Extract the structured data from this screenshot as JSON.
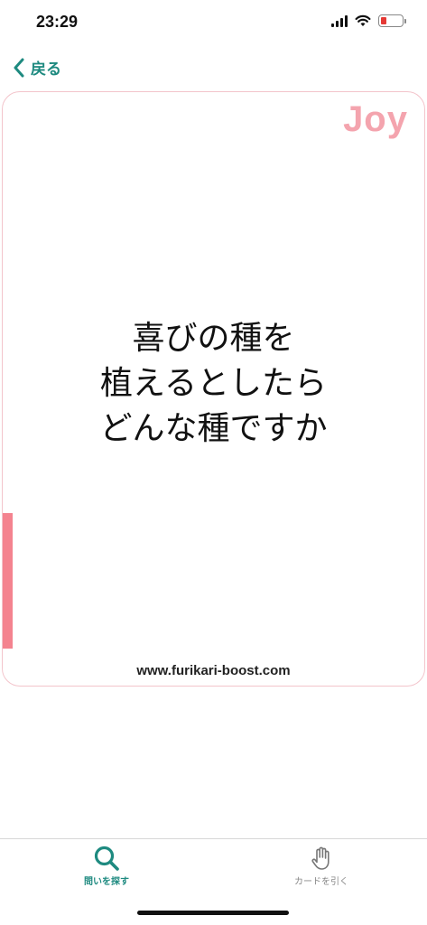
{
  "status_bar": {
    "time": "23:29",
    "battery_color": "#e53935",
    "icons": [
      "signal-icon",
      "wifi-icon",
      "battery-icon"
    ]
  },
  "nav": {
    "back_label": "戻る",
    "accent_color": "#1e8a80"
  },
  "card": {
    "category": "Joy",
    "question_lines": [
      "喜びの種を",
      "植えるとしたら",
      "どんな種ですか"
    ],
    "url": "www.furikari-boost.com",
    "accent_color": "#f4838f",
    "border_color": "#f3c4cb"
  },
  "tab_bar": {
    "tabs": [
      {
        "label": "問いを探す",
        "icon": "search-icon",
        "active": true
      },
      {
        "label": "カードを引く",
        "icon": "hand-icon",
        "active": false
      }
    ]
  }
}
